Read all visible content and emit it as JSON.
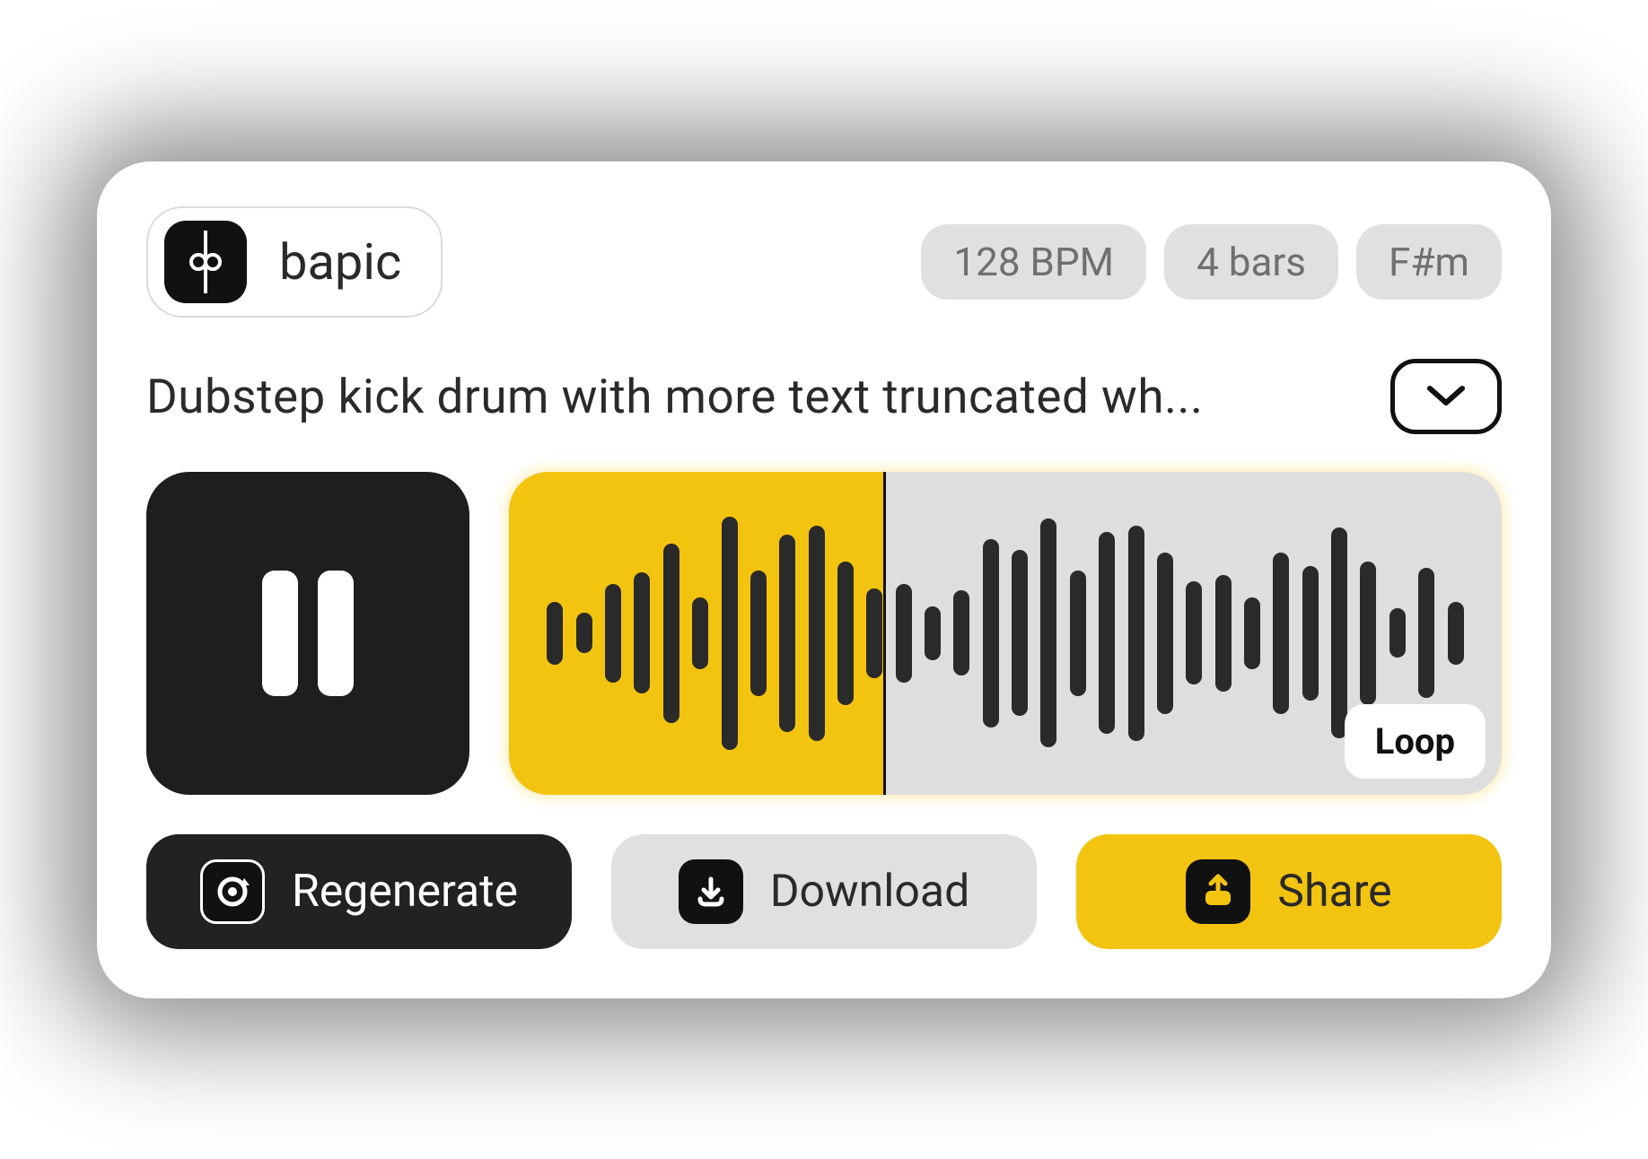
{
  "brand": {
    "name": "bapic"
  },
  "meta": {
    "bpm": "128 BPM",
    "bars": "4 bars",
    "key": "F#m"
  },
  "description": "Dubstep kick drum with more text truncated wh...",
  "player": {
    "state": "playing",
    "progress_pct": 38,
    "loop_label": "Loop",
    "waveform_heights": [
      70,
      45,
      110,
      135,
      200,
      80,
      260,
      140,
      220,
      240,
      160,
      100,
      110,
      60,
      95,
      210,
      185,
      255,
      140,
      225,
      240,
      180,
      115,
      130,
      80,
      180,
      150,
      235,
      160,
      55,
      145,
      70
    ]
  },
  "actions": {
    "regenerate": "Regenerate",
    "download": "Download",
    "share": "Share"
  },
  "colors": {
    "accent": "#f3c40f",
    "dark": "#1e1e1e",
    "gray": "#e0e0e0"
  }
}
